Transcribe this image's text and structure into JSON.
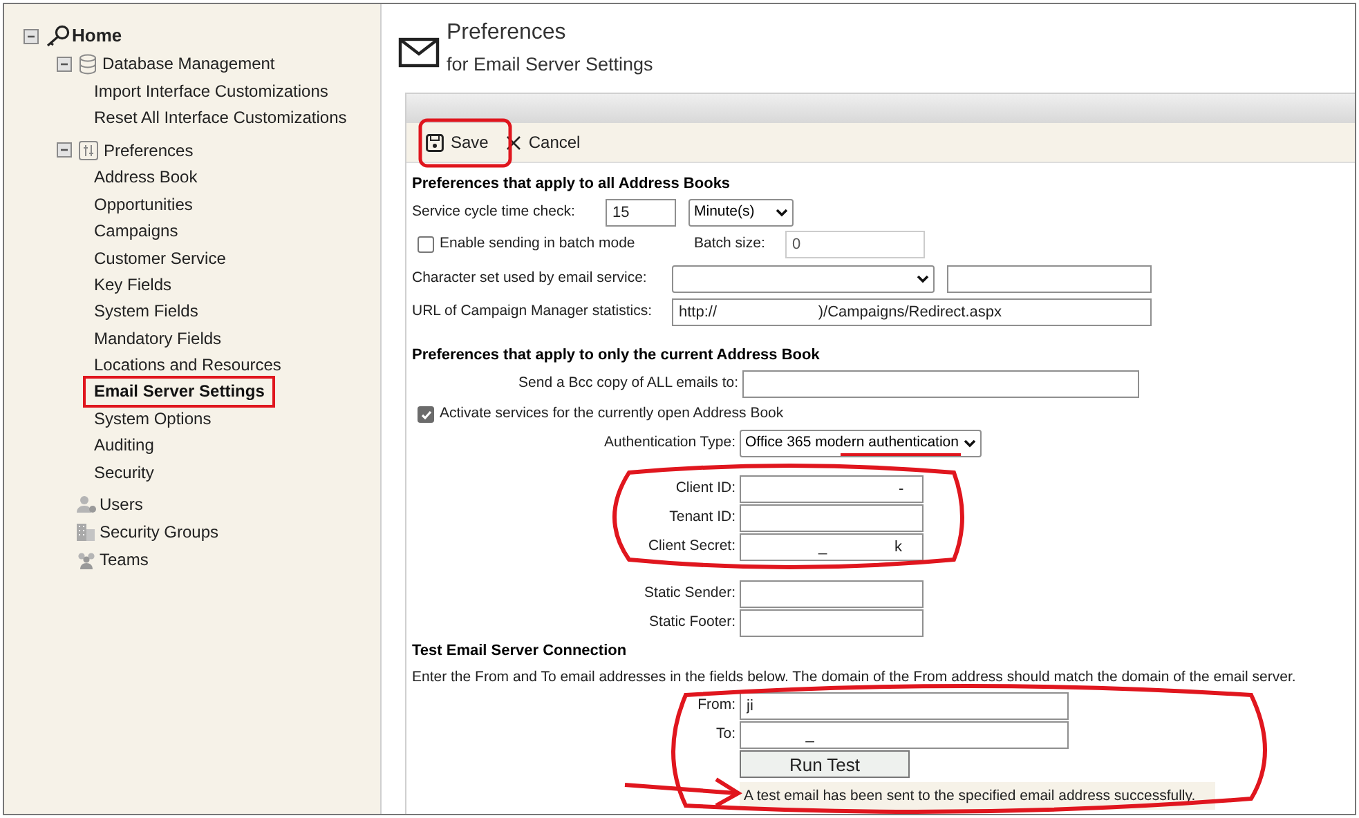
{
  "sidebar": {
    "root": {
      "label": "Home",
      "expanded": true,
      "children": [
        {
          "label": "Database Management",
          "kind": "database",
          "expanded": true,
          "children": [
            {
              "label": "Import Interface Customizations",
              "selected": false
            },
            {
              "label": "Reset All Interface Customizations",
              "selected": false
            }
          ]
        },
        {
          "label": "Preferences",
          "kind": "preferences",
          "expanded": true,
          "children": [
            {
              "label": "Address Book",
              "selected": false
            },
            {
              "label": "Opportunities",
              "selected": false
            },
            {
              "label": "Campaigns",
              "selected": false
            },
            {
              "label": "Customer Service",
              "selected": false
            },
            {
              "label": "Key Fields",
              "selected": false
            },
            {
              "label": "System Fields",
              "selected": false
            },
            {
              "label": "Mandatory Fields",
              "selected": false
            },
            {
              "label": "Locations and Resources",
              "selected": false
            },
            {
              "label": "Email Server Settings",
              "selected": true
            },
            {
              "label": "System Options",
              "selected": false
            },
            {
              "label": "Auditing",
              "selected": false
            },
            {
              "label": "Security",
              "selected": false
            }
          ]
        },
        {
          "label": "Users",
          "kind": "users"
        },
        {
          "label": "Security Groups",
          "kind": "groups"
        },
        {
          "label": "Teams",
          "kind": "teams"
        }
      ]
    }
  },
  "header": {
    "title": "Preferences",
    "subtitle": "for Email Server Settings"
  },
  "toolbar": [
    {
      "label": "Save",
      "kind": "save"
    },
    {
      "label": "Cancel",
      "kind": "cancel"
    }
  ],
  "all_books": {
    "heading": "Preferences that apply to all Address Books",
    "service_cycle": {
      "label": "Service cycle time check:",
      "value": "15",
      "unit": "Minute(s)"
    },
    "batch_mode": {
      "label": "Enable sending in batch mode",
      "checked": false
    },
    "batch_size": {
      "label": "Batch size:",
      "value": "0"
    },
    "charset": {
      "label": "Character set used by email service:"
    },
    "url": {
      "label": "URL of Campaign Manager statistics:",
      "value": "http://                        )/Campaigns/Redirect.aspx"
    }
  },
  "current_book": {
    "heading": "Preferences that apply to only the current Address Book",
    "bcc": {
      "label": "Send a Bcc copy of ALL emails to:"
    },
    "activate": {
      "label": "Activate services for the currently open Address Book",
      "checked": true
    },
    "auth_type": {
      "label": "Authentication Type:",
      "value": "Office 365 modern authentication"
    },
    "fields": [
      {
        "label": "Client ID:",
        "value": "                                    -"
      },
      {
        "label": "Tenant ID:"
      },
      {
        "label": "Client Secret:",
        "value": "                 _                k"
      },
      {
        "label": "Static Sender:"
      },
      {
        "label": "Static Footer:"
      }
    ]
  },
  "test": {
    "heading": "Test Email Server Connection",
    "description": "Enter the From and To email addresses in the fields below. The domain of the From address should match the domain of the email server.",
    "from": {
      "label": "From:",
      "value": "ji"
    },
    "to": {
      "label": "To:",
      "value": "              _"
    },
    "button": "Run Test",
    "message": "A test email has been sent to the specified email address successfully."
  }
}
